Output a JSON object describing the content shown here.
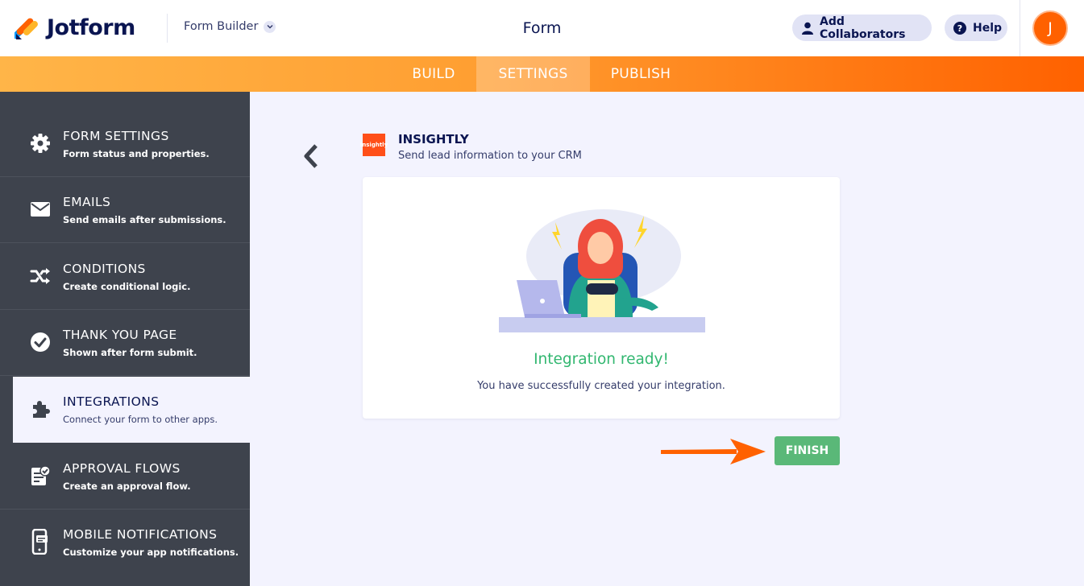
{
  "header": {
    "brand": "Jotform",
    "builder_label": "Form Builder",
    "form_title": "Form",
    "collaborators_label": "Add Collaborators",
    "help_label": "Help",
    "avatar_initial": "J"
  },
  "tabs": [
    {
      "label": "BUILD"
    },
    {
      "label": "SETTINGS",
      "active": true
    },
    {
      "label": "PUBLISH"
    }
  ],
  "sidebar": {
    "items": [
      {
        "title": "FORM SETTINGS",
        "subtitle": "Form status and properties.",
        "icon": "gear-icon"
      },
      {
        "title": "EMAILS",
        "subtitle": "Send emails after submissions.",
        "icon": "envelope-icon"
      },
      {
        "title": "CONDITIONS",
        "subtitle": "Create conditional logic.",
        "icon": "shuffle-icon"
      },
      {
        "title": "THANK YOU PAGE",
        "subtitle": "Shown after form submit.",
        "icon": "check-circle-icon"
      },
      {
        "title": "INTEGRATIONS",
        "subtitle": "Connect your form to other apps.",
        "icon": "puzzle-icon",
        "active": true
      },
      {
        "title": "APPROVAL FLOWS",
        "subtitle": "Create an approval flow.",
        "icon": "approval-doc-icon"
      },
      {
        "title": "MOBILE NOTIFICATIONS",
        "subtitle": "Customize your app notifications.",
        "icon": "mobile-notification-icon"
      }
    ]
  },
  "integration": {
    "logo_text": "insightly",
    "name": "INSIGHTLY",
    "description": "Send lead information to your CRM",
    "status_title": "Integration ready!",
    "status_message": "You have successfully created your integration.",
    "finish_label": "FINISH"
  },
  "colors": {
    "brand_orange": "#ff6100",
    "sidebar_bg": "#3e434d",
    "success_green": "#32b770",
    "finish_green": "#5ab878",
    "navy": "#0a1551"
  }
}
